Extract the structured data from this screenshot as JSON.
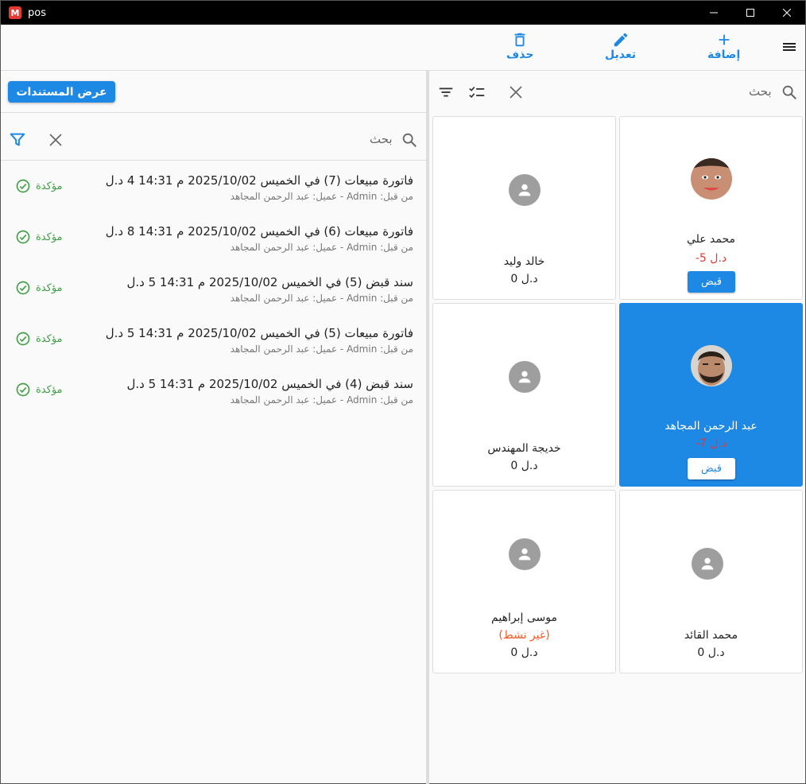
{
  "window": {
    "title": "pos",
    "logo": "M"
  },
  "toolbar": {
    "add_label": "إضافة",
    "edit_label": "تعديل",
    "delete_label": "حذف"
  },
  "left": {
    "docs_button": "عرض المستندات",
    "search_label": "بحث",
    "documents": [
      {
        "title": "فاتورة مبيعات (7) في الخميس 2025/10/02 م 14:31   4 د.ل",
        "sub": "من قبل: Admin  -  عميل: عبد الرحمن المجاهد",
        "status": "مؤكدة"
      },
      {
        "title": "فاتورة مبيعات (6) في الخميس 2025/10/02 م 14:31   8 د.ل",
        "sub": "من قبل: Admin  -  عميل: عبد الرحمن المجاهد",
        "status": "مؤكدة"
      },
      {
        "title": "سند قبض (5) في الخميس 2025/10/02 م 14:31   5 د.ل",
        "sub": "من قبل: Admin  -  عميل: عبد الرحمن المجاهد",
        "status": "مؤكدة"
      },
      {
        "title": "فاتورة مبيعات (5) في الخميس 2025/10/02 م 14:31   5 د.ل",
        "sub": "من قبل: Admin  -  عميل: عبد الرحمن المجاهد",
        "status": "مؤكدة"
      },
      {
        "title": "سند قبض (4) في الخميس 2025/10/02 م 14:31   5 د.ل",
        "sub": "من قبل: Admin  -  عميل: عبد الرحمن المجاهد",
        "status": "مؤكدة"
      }
    ]
  },
  "right": {
    "search_label": "بحث",
    "customers": [
      {
        "name": "محمد علي",
        "balance": "-5 د.ل",
        "button": "قبض"
      },
      {
        "name": "خالد وليد",
        "balance": "0 د.ل"
      },
      {
        "name": "عبد الرحمن المجاهد",
        "balance": "-7 د.ل",
        "button": "قبض"
      },
      {
        "name": "خديجة المهندس",
        "balance": "0 د.ل"
      },
      {
        "name": "محمد القائد",
        "balance": "0 د.ل"
      },
      {
        "name": "موسى إبراهيم",
        "status": "(غير نشط)",
        "balance": "0 د.ل"
      }
    ]
  },
  "colors": {
    "accent": "#1e88e5",
    "confirmed": "#43a047",
    "negative": "#e53935",
    "inactive": "#ff5722"
  }
}
